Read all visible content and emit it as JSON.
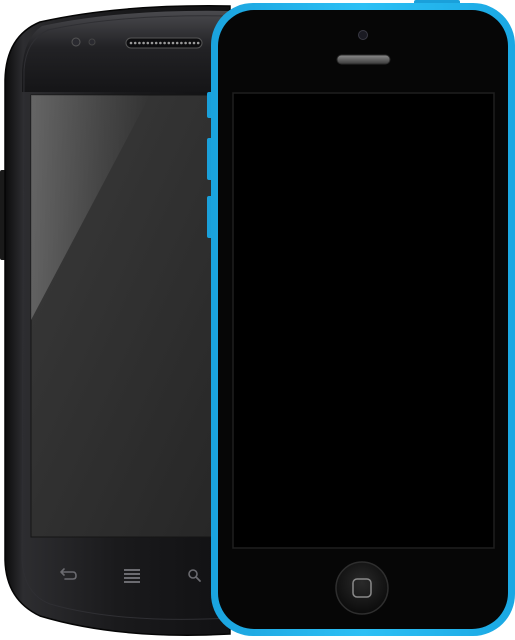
{
  "scene": {
    "background": "#ffffff"
  },
  "android_phone": {
    "body_color": "#1b1b1d",
    "screen_color": "#303030",
    "nav_keys": [
      {
        "name": "back",
        "icon": "back-arrow-icon"
      },
      {
        "name": "menu",
        "icon": "menu-lines-icon"
      },
      {
        "name": "search",
        "icon": "search-icon"
      }
    ]
  },
  "iphone": {
    "frame_color": "#1fb2ee",
    "body_color": "#050505",
    "screen_color": "#000000",
    "home_button": {
      "icon": "home-square-icon"
    }
  }
}
